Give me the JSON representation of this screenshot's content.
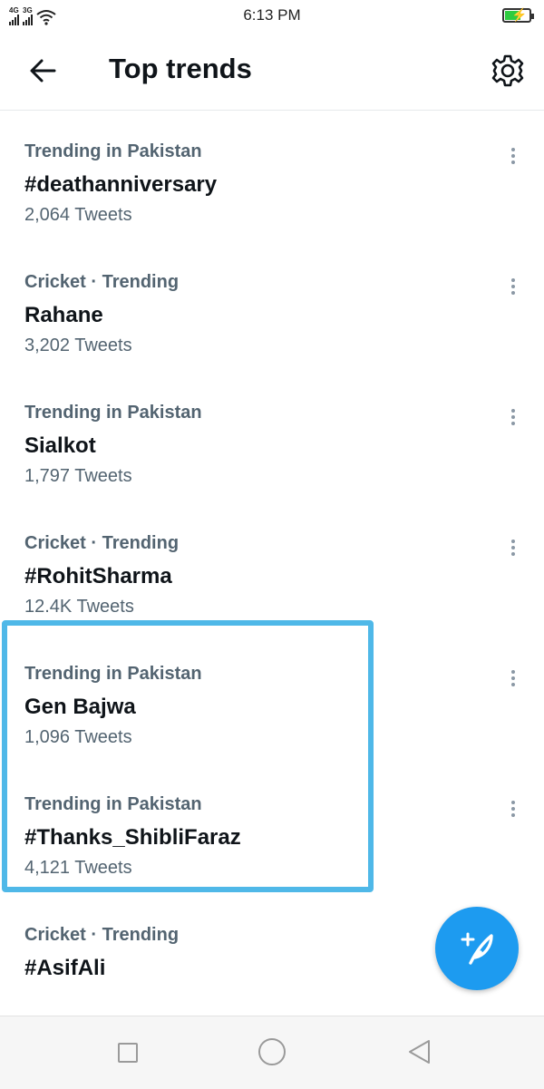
{
  "status_bar": {
    "net1": "4G",
    "net2": "3G",
    "time": "6:13 PM",
    "battery_color": "#2ecc40"
  },
  "header": {
    "title": "Top trends",
    "back_icon": "arrow-left-icon",
    "settings_icon": "gear-icon"
  },
  "trends": [
    {
      "context": "Trending in Pakistan",
      "name": "#deathanniversary",
      "count": "2,064 Tweets"
    },
    {
      "context": "Cricket · Trending",
      "name": "Rahane",
      "count": "3,202 Tweets"
    },
    {
      "context": "Trending in Pakistan",
      "name": "Sialkot",
      "count": "1,797 Tweets"
    },
    {
      "context": "Cricket · Trending",
      "name": "#RohitSharma",
      "count": "12.4K Tweets"
    },
    {
      "context": "Trending in Pakistan",
      "name": "Gen Bajwa",
      "count": "1,096 Tweets"
    },
    {
      "context": "Trending in Pakistan",
      "name": "#Thanks_ShibliFaraz",
      "count": "4,121 Tweets"
    },
    {
      "context": "Cricket · Trending",
      "name": "#AsifAli",
      "count": ""
    }
  ],
  "highlight_color": "#4fb8e8",
  "fab": {
    "icon": "compose-tweet-icon",
    "color": "#1d9bf0"
  },
  "nav_bar": {
    "icons": [
      "recent-apps-icon",
      "home-icon",
      "back-icon"
    ]
  }
}
